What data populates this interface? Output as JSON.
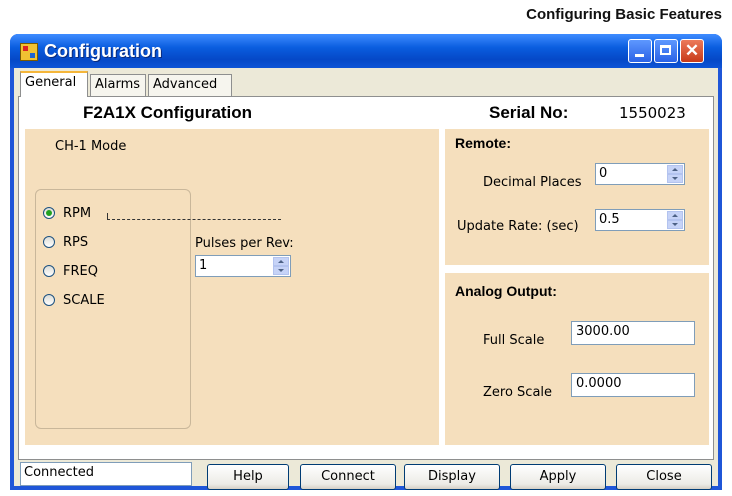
{
  "page_heading": "Configuring Basic Features",
  "window": {
    "title": "Configuration",
    "controls": {
      "minimize_icon": "minimize-icon",
      "maximize_icon": "maximize-icon",
      "close_icon": "close-icon"
    }
  },
  "tabs": [
    {
      "label": "General",
      "active": true
    },
    {
      "label": "Alarms",
      "active": false
    },
    {
      "label": "Advanced",
      "active": false
    }
  ],
  "general": {
    "config_title": "F2A1X Configuration",
    "serial_label": "Serial No:",
    "serial_value": "1550023",
    "ch1_mode_label": "CH-1 Mode",
    "modes": [
      {
        "label": "RPM",
        "selected": true
      },
      {
        "label": "RPS",
        "selected": false
      },
      {
        "label": "FREQ",
        "selected": false
      },
      {
        "label": "SCALE",
        "selected": false
      }
    ],
    "pulses_label": "Pulses per Rev:",
    "pulses_value": "1"
  },
  "remote": {
    "title": "Remote:",
    "decimal_places_label": "Decimal Places",
    "decimal_places_value": "0",
    "update_rate_label": "Update Rate: (sec)",
    "update_rate_value": "0.5"
  },
  "analog_output": {
    "title": "Analog Output:",
    "full_scale_label": "Full Scale",
    "full_scale_value": "3000.00",
    "zero_scale_label": "Zero Scale",
    "zero_scale_value": "0.0000"
  },
  "footer": {
    "status": "Connected",
    "buttons": {
      "help": "Help",
      "connect": "Connect",
      "display": "Display",
      "apply": "Apply",
      "close": "Close"
    }
  },
  "colors": {
    "panel": "#f5dfbd",
    "title_bar": "#0a5ddf",
    "window_border": "#1f56d8",
    "client": "#ece9d8",
    "close_button": "#c83a19"
  }
}
